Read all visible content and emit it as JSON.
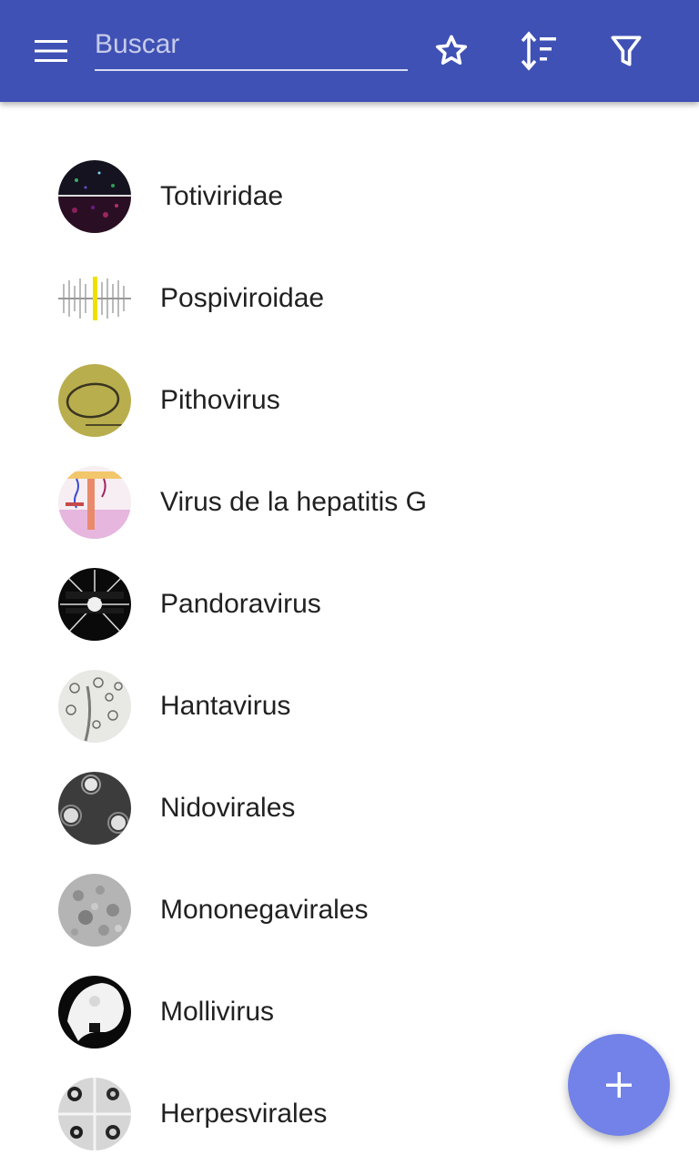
{
  "header": {
    "search_placeholder": "Buscar",
    "icons": {
      "menu": "menu-icon",
      "star": "star-outline-icon",
      "sort": "sort-icon",
      "filter": "filter-icon"
    }
  },
  "list": {
    "items": [
      {
        "label": "Totiviridae"
      },
      {
        "label": "Pospiviroidae"
      },
      {
        "label": "Pithovirus"
      },
      {
        "label": "Virus de la hepatitis G"
      },
      {
        "label": "Pandoravirus"
      },
      {
        "label": "Hantavirus"
      },
      {
        "label": "Nidovirales"
      },
      {
        "label": "Mononegavirales"
      },
      {
        "label": "Mollivirus"
      },
      {
        "label": "Herpesvirales"
      }
    ]
  },
  "fab": {
    "icon": "add-icon"
  },
  "colors": {
    "appbar": "#3f51b5",
    "fab": "#7282e8",
    "text": "#212121"
  }
}
